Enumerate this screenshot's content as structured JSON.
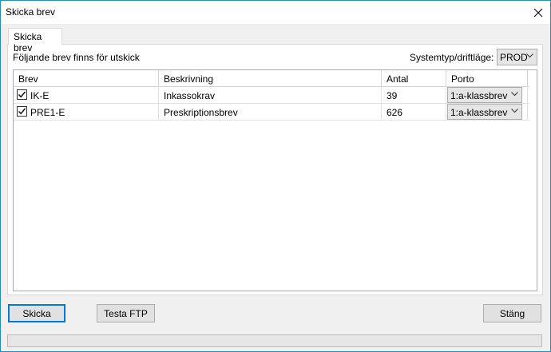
{
  "window": {
    "title": "Skicka brev"
  },
  "tab": {
    "label": "Skicka brev"
  },
  "panel": {
    "caption": "Följande brev finns för utskick",
    "systype_label": "Systemtyp/driftläge:",
    "systype_value": "PROD"
  },
  "grid": {
    "columns": [
      "Brev",
      "Beskrivning",
      "Antal",
      "Porto"
    ],
    "rows": [
      {
        "checked": true,
        "brev": "IK-E",
        "beskrivning": "Inkassokrav",
        "antal": "39",
        "porto": "1:a-klassbrev"
      },
      {
        "checked": true,
        "brev": "PRE1-E",
        "beskrivning": "Preskriptionsbrev",
        "antal": "626",
        "porto": "1:a-klassbrev"
      }
    ]
  },
  "buttons": {
    "send": "Skicka",
    "test_ftp": "Testa FTP",
    "close": "Stäng"
  },
  "progress": {
    "value": 0
  }
}
